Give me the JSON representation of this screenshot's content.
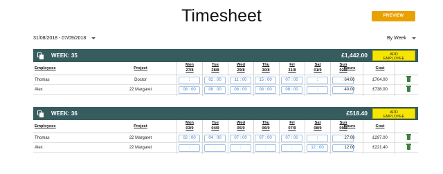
{
  "page": {
    "title": "Timesheet",
    "preview_label": "PREVIEW",
    "date_range": "31/08/2018 - 07/09/2018",
    "view_mode": "By Week"
  },
  "columns": {
    "employees": "Employees",
    "project": "Project",
    "hours": "Hours",
    "cost": "Cost"
  },
  "weeks": [
    {
      "label": "WEEK: 35",
      "total": "£1,442.00",
      "add_label_1": "ADD",
      "add_label_2": "EMPLOYEE",
      "days": [
        {
          "name": "Mon",
          "date": "27/8"
        },
        {
          "name": "Tue",
          "date": "28/8"
        },
        {
          "name": "Wed",
          "date": "29/8"
        },
        {
          "name": "Thu",
          "date": "30/8"
        },
        {
          "name": "Fri",
          "date": "31/8"
        },
        {
          "name": "Sat",
          "date": "01/9"
        },
        {
          "name": "Sun",
          "date": "02/9"
        }
      ],
      "rows": [
        {
          "employee": "Thomas",
          "project": "Doctor",
          "times": [
            "  :  ",
            "02 : 00",
            "11 : 00",
            "15 : 00",
            "07 : 00",
            "  :  ",
            "  :  "
          ],
          "hours": "64:00",
          "cost": "£704.00"
        },
        {
          "employee": "Alex",
          "project": "22 Margaret",
          "times": [
            "08 : 00",
            "08 : 00",
            "08 : 00",
            "08 : 00",
            "08 : 00",
            "  :  ",
            "  :  "
          ],
          "hours": "40:00",
          "cost": "£738.00"
        }
      ]
    },
    {
      "label": "WEEK: 36",
      "total": "£518.40",
      "add_label_1": "ADD",
      "add_label_2": "EMPLOYEE",
      "days": [
        {
          "name": "Mon",
          "date": "03/9"
        },
        {
          "name": "Tue",
          "date": "04/9"
        },
        {
          "name": "Wed",
          "date": "05/9"
        },
        {
          "name": "Thu",
          "date": "06/9"
        },
        {
          "name": "Fri",
          "date": "07/9"
        },
        {
          "name": "Sat",
          "date": "08/9"
        },
        {
          "name": "Sun",
          "date": "09/9"
        }
      ],
      "rows": [
        {
          "employee": "Thomas",
          "project": "22 Margaret",
          "times": [
            "02 : 00",
            "04 : 00",
            "07 : 00",
            "07 : 00",
            "07 : 00",
            "  :  ",
            "  :  "
          ],
          "hours": "27:00",
          "cost": "£297.00"
        },
        {
          "employee": "Alex",
          "project": "22 Margaret",
          "times": [
            "  :  ",
            "  :  ",
            "  :  ",
            "  :  ",
            "  :  ",
            "12 : 00",
            "  :  "
          ],
          "hours": "12:00",
          "cost": "£221.40"
        }
      ]
    }
  ]
}
